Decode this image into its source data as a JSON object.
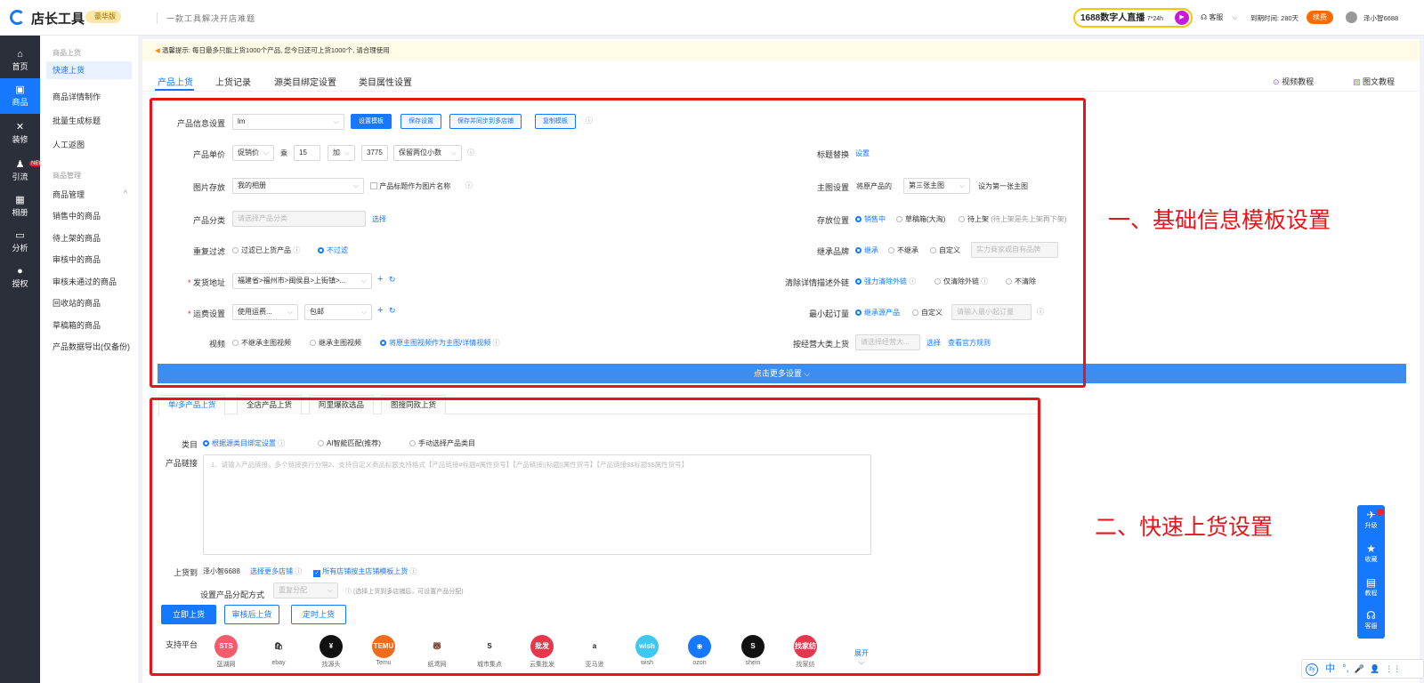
{
  "header": {
    "brand": "店长工具",
    "vip": "豪华版",
    "slogan": "一款工具解决开店难题",
    "live": "1688数字人直播",
    "live_tag": "7*24h",
    "service": "客服",
    "expire": "到期时间: 280天",
    "renew": "续费",
    "user": "泽小智6688"
  },
  "leftnav": [
    {
      "label": "首页",
      "icon": "home-icon"
    },
    {
      "label": "商品",
      "icon": "goods-icon"
    },
    {
      "label": "装修",
      "icon": "tools-icon"
    },
    {
      "label": "引流",
      "icon": "user-icon",
      "badge": "NEW"
    },
    {
      "label": "相册",
      "icon": "album-icon"
    },
    {
      "label": "分析",
      "icon": "monitor-icon"
    },
    {
      "label": "授权",
      "icon": "pin-icon"
    }
  ],
  "submenu": {
    "group1": "商品上货",
    "items1": [
      "快速上货",
      "商品详情制作",
      "批量生成标题",
      "人工返图"
    ],
    "group2": "商品管理",
    "group2b": "商品管理",
    "items2": [
      "销售中的商品",
      "待上架的商品",
      "审核中的商品",
      "审核未通过的商品",
      "回收站的商品",
      "草稿箱的商品",
      "产品数据导出(仅备份)"
    ]
  },
  "notice": "温馨提示: 每日最多只能上货1000个产品, 您今日还可上货1000个, 请合理使用",
  "tabs": [
    "产品上货",
    "上货记录",
    "源类目绑定设置",
    "类目属性设置"
  ],
  "tutorials": {
    "video": "视频教程",
    "doc": "图文教程"
  },
  "form": {
    "info_label": "产品信息设置",
    "info_value": "lm",
    "btn_set": "设置模板",
    "btn_save": "保存设置",
    "btn_save_sync": "保存并同步到多店铺",
    "btn_copy": "复制模板",
    "price_label": "产品单价",
    "price_sel": "促销价",
    "mul": "乘",
    "mul_val": "15",
    "add": "加",
    "add_val": "3775",
    "round": "保留两位小数",
    "img_label": "图片存放",
    "img_sel": "我的相册",
    "img_check": "产品标题作为图片名称",
    "cat_label": "产品分类",
    "cat_ph": "请选择产品分类",
    "cat_btn": "选择",
    "dup_label": "重复过滤",
    "dup_o1": "过滤已上货产品",
    "dup_o2": "不过滤",
    "addr_label": "发货地址",
    "addr_val": "福建省>福州市>闽侯县>上街镇>...",
    "ship_label": "运费设置",
    "ship_val": "使用运费...",
    "ship_val2": "包邮",
    "video_label": "视频",
    "video_o1": "不继承主图视频",
    "video_o2": "继承主图视频",
    "video_o3": "将原主图视频作为主图/详情视频",
    "title_label": "标题替换",
    "title_btn": "设置",
    "main_label": "主图设置",
    "main_t1": "将原产品的",
    "main_sel": "第三张主图",
    "main_t2": "设为第一张主图",
    "pos_label": "存放位置",
    "pos_o1": "销售中",
    "pos_o2": "草稿箱(大淘)",
    "pos_o3": "待上架",
    "pos_note": "(待上架是先上架再下架)",
    "brand_label": "继承品牌",
    "brand_o1": "继承",
    "brand_o2": "不继承",
    "brand_o3": "自定义",
    "brand_ph": "实力商家或自有品牌",
    "link_label": "清除详情描述外链",
    "link_o1": "强力清除外链",
    "link_o2": "仅清除外链",
    "link_o3": "不清除",
    "moq_label": "最小起订量",
    "moq_o1": "继承源产品",
    "moq_o2": "自定义",
    "moq_ph": "请输入最小起订量",
    "cls_label": "按经营大类上货",
    "cls_ph": "请选择经营大...",
    "cls_btn": "选择",
    "cls_rule": "查看官方规则",
    "more": "点击更多设置"
  },
  "quick": {
    "tabs": [
      "单/多产品上货",
      "全店产品上货",
      "阿里爆款选品",
      "图搜同款上货"
    ],
    "cat_label": "类目",
    "cat_o1": "根据源类目绑定设置",
    "cat_o2": "AI智能匹配(推荐)",
    "cat_o3": "手动选择产品类目",
    "link_label": "产品链接",
    "link_ph": "1、请输入产品链接，多个链接换行分隔2、支持自定义商品标题支持格式【产品链接#标题#属性货号】【产品链接||标题||属性货号】【产品链接$$标题$$属性货号】",
    "to_label": "上货到",
    "to_shop": "泽小智6688",
    "to_more": "选择更多店铺",
    "to_check": "所有店铺按主店铺模板上货",
    "dist_label": "设置产品分配方式",
    "dist_sel": "重复分配",
    "dist_note": "(选择上货到多店铺后，可设置产品分配)",
    "btn_now": "立即上货",
    "btn_review": "审核后上货",
    "btn_timer": "定时上货",
    "plat_label": "支持平台",
    "expand": "展开",
    "platforms": [
      {
        "name": "蓝湖网",
        "logo": "STS",
        "color": "#f45b6c"
      },
      {
        "name": "ebay",
        "logo": "🛍",
        "color": "#ffffff"
      },
      {
        "name": "找源头",
        "logo": "¥",
        "color": "#111111"
      },
      {
        "name": "Temu",
        "logo": "TEMU",
        "color": "#f26b1d"
      },
      {
        "name": "纸鸢网",
        "logo": "🐻",
        "color": "#ffffff"
      },
      {
        "name": "城市集点",
        "logo": "S",
        "color": "#ffffff"
      },
      {
        "name": "云集批发",
        "logo": "批发",
        "color": "#e8364c"
      },
      {
        "name": "亚马逊",
        "logo": "a",
        "color": "#ffffff"
      },
      {
        "name": "wish",
        "logo": "wish",
        "color": "#3cc8f0"
      },
      {
        "name": "ozon",
        "logo": "◉",
        "color": "#1677ff"
      },
      {
        "name": "shein",
        "logo": "S",
        "color": "#111111"
      },
      {
        "name": "找家纺",
        "logo": "找家纺",
        "color": "#e8364c"
      }
    ]
  },
  "annotations": {
    "a1": "一、基础信息模板设置",
    "a2": "二、快速上货设置"
  },
  "float": [
    {
      "label": "升级",
      "icon": "rocket-icon"
    },
    {
      "label": "收藏",
      "icon": "star-icon"
    },
    {
      "label": "教程",
      "icon": "book-icon"
    },
    {
      "label": "客服",
      "icon": "headset-icon"
    }
  ],
  "ime": [
    "中",
    "°,",
    "🎤",
    "👤",
    "⋮⋮"
  ]
}
